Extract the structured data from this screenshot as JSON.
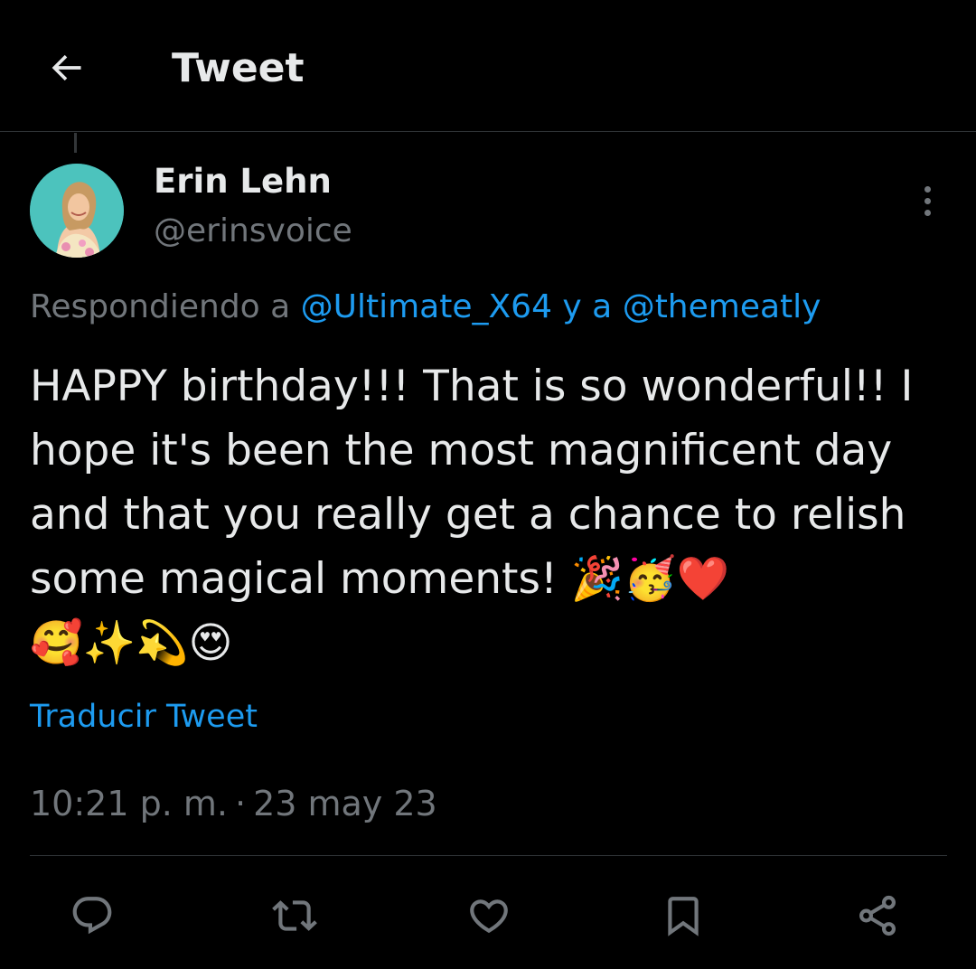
{
  "header": {
    "title": "Tweet",
    "back_icon": "arrow-left-icon"
  },
  "tweet": {
    "author": {
      "display_name": "Erin Lehn",
      "handle": "@erinsvoice"
    },
    "replying_to": {
      "prefix": "Respondiendo a ",
      "mention_1": "@Ultimate_X64",
      "joiner": " y a ",
      "mention_2": "@themeatly"
    },
    "text": "HAPPY birthday!!! That is so wonderful!! I hope it's been the most magnificent day and that you really get a chance to relish some magical moments! ",
    "emojis_line1": "🎉🥳❤️",
    "emojis_line2": "🥰✨💫😍",
    "translate_label": "Traducir Tweet",
    "time": "10:21 p. m.",
    "separator": "·",
    "date": "23 may 23"
  },
  "actions": [
    {
      "name": "reply",
      "icon": "reply-bubble-icon"
    },
    {
      "name": "retweet",
      "icon": "retweet-icon"
    },
    {
      "name": "like",
      "icon": "heart-icon"
    },
    {
      "name": "bookmark",
      "icon": "bookmark-icon"
    },
    {
      "name": "share",
      "icon": "share-icon"
    }
  ],
  "colors": {
    "background": "#000000",
    "text_primary": "#e7e9ea",
    "text_secondary": "#71767b",
    "link": "#1d9bf0",
    "divider": "#2f3336"
  }
}
